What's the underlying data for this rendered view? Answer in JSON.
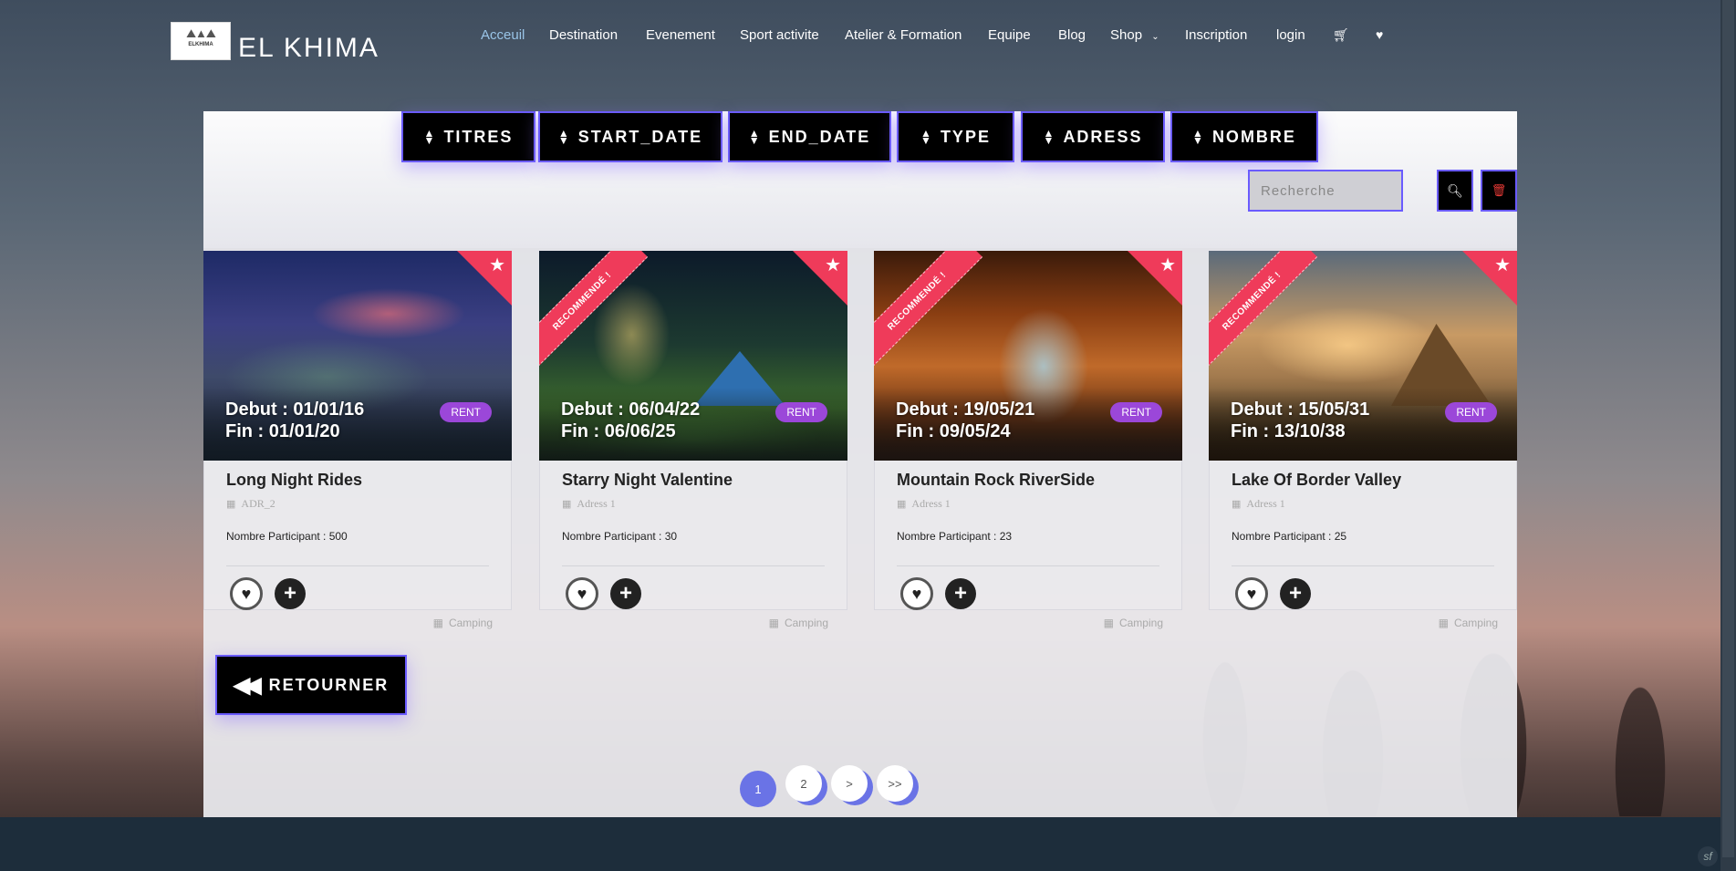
{
  "header": {
    "logo_text": "ELKHIMA",
    "site_name": "EL KHIMA",
    "nav": [
      {
        "label": "Acceuil",
        "active": true
      },
      {
        "label": "Destination"
      },
      {
        "label": "Evenement"
      },
      {
        "label": "Sport activite"
      },
      {
        "label": "Atelier & Formation"
      },
      {
        "label": "Equipe"
      },
      {
        "label": "Blog"
      },
      {
        "label": "Shop"
      },
      {
        "label": "Inscription"
      },
      {
        "label": "login"
      }
    ],
    "cart_icon": "cart-icon",
    "wishlist_icon": "heart-icon"
  },
  "sort_buttons": [
    "TITRES",
    "START_DATE",
    "END_DATE",
    "TYPE",
    "ADRESS",
    "NOMBRE"
  ],
  "search": {
    "placeholder": "Recherche",
    "value": ""
  },
  "cards": [
    {
      "debut": "Debut : 01/01/16",
      "fin": "Fin : 01/01/20",
      "badge": "RENT",
      "title": "Long Night Rides",
      "address": "ADR_2",
      "count": "Nombre Participant : 500",
      "category": "Camping",
      "recommended": false
    },
    {
      "debut": "Debut : 06/04/22",
      "fin": "Fin : 06/06/25",
      "badge": "RENT",
      "title": "Starry Night Valentine",
      "address": "Adress 1",
      "count": "Nombre Participant : 30",
      "category": "Camping",
      "recommended": true,
      "ribbon": "RECOMMENDÉ !"
    },
    {
      "debut": "Debut : 19/05/21",
      "fin": "Fin : 09/05/24",
      "badge": "RENT",
      "title": "Mountain Rock RiverSide",
      "address": "Adress 1",
      "count": "Nombre Participant : 23",
      "category": "Camping",
      "recommended": true,
      "ribbon": "RECOMMENDÉ !"
    },
    {
      "debut": "Debut : 15/05/31",
      "fin": "Fin : 13/10/38",
      "badge": "RENT",
      "title": "Lake Of Border Valley",
      "address": "Adress 1",
      "count": "Nombre Participant : 25",
      "category": "Camping",
      "recommended": true,
      "ribbon": "RECOMMENDÉ !"
    }
  ],
  "back_button": "RETOURNER",
  "pagination": {
    "pages": [
      "1",
      "2",
      ">",
      ">>"
    ],
    "current": "1"
  },
  "colors": {
    "accent": "#6a5bff",
    "ribbon": "#ef3b5a",
    "badge": "#9b47d9",
    "page": "#6a73e6",
    "footer": "#1d2d3b"
  }
}
